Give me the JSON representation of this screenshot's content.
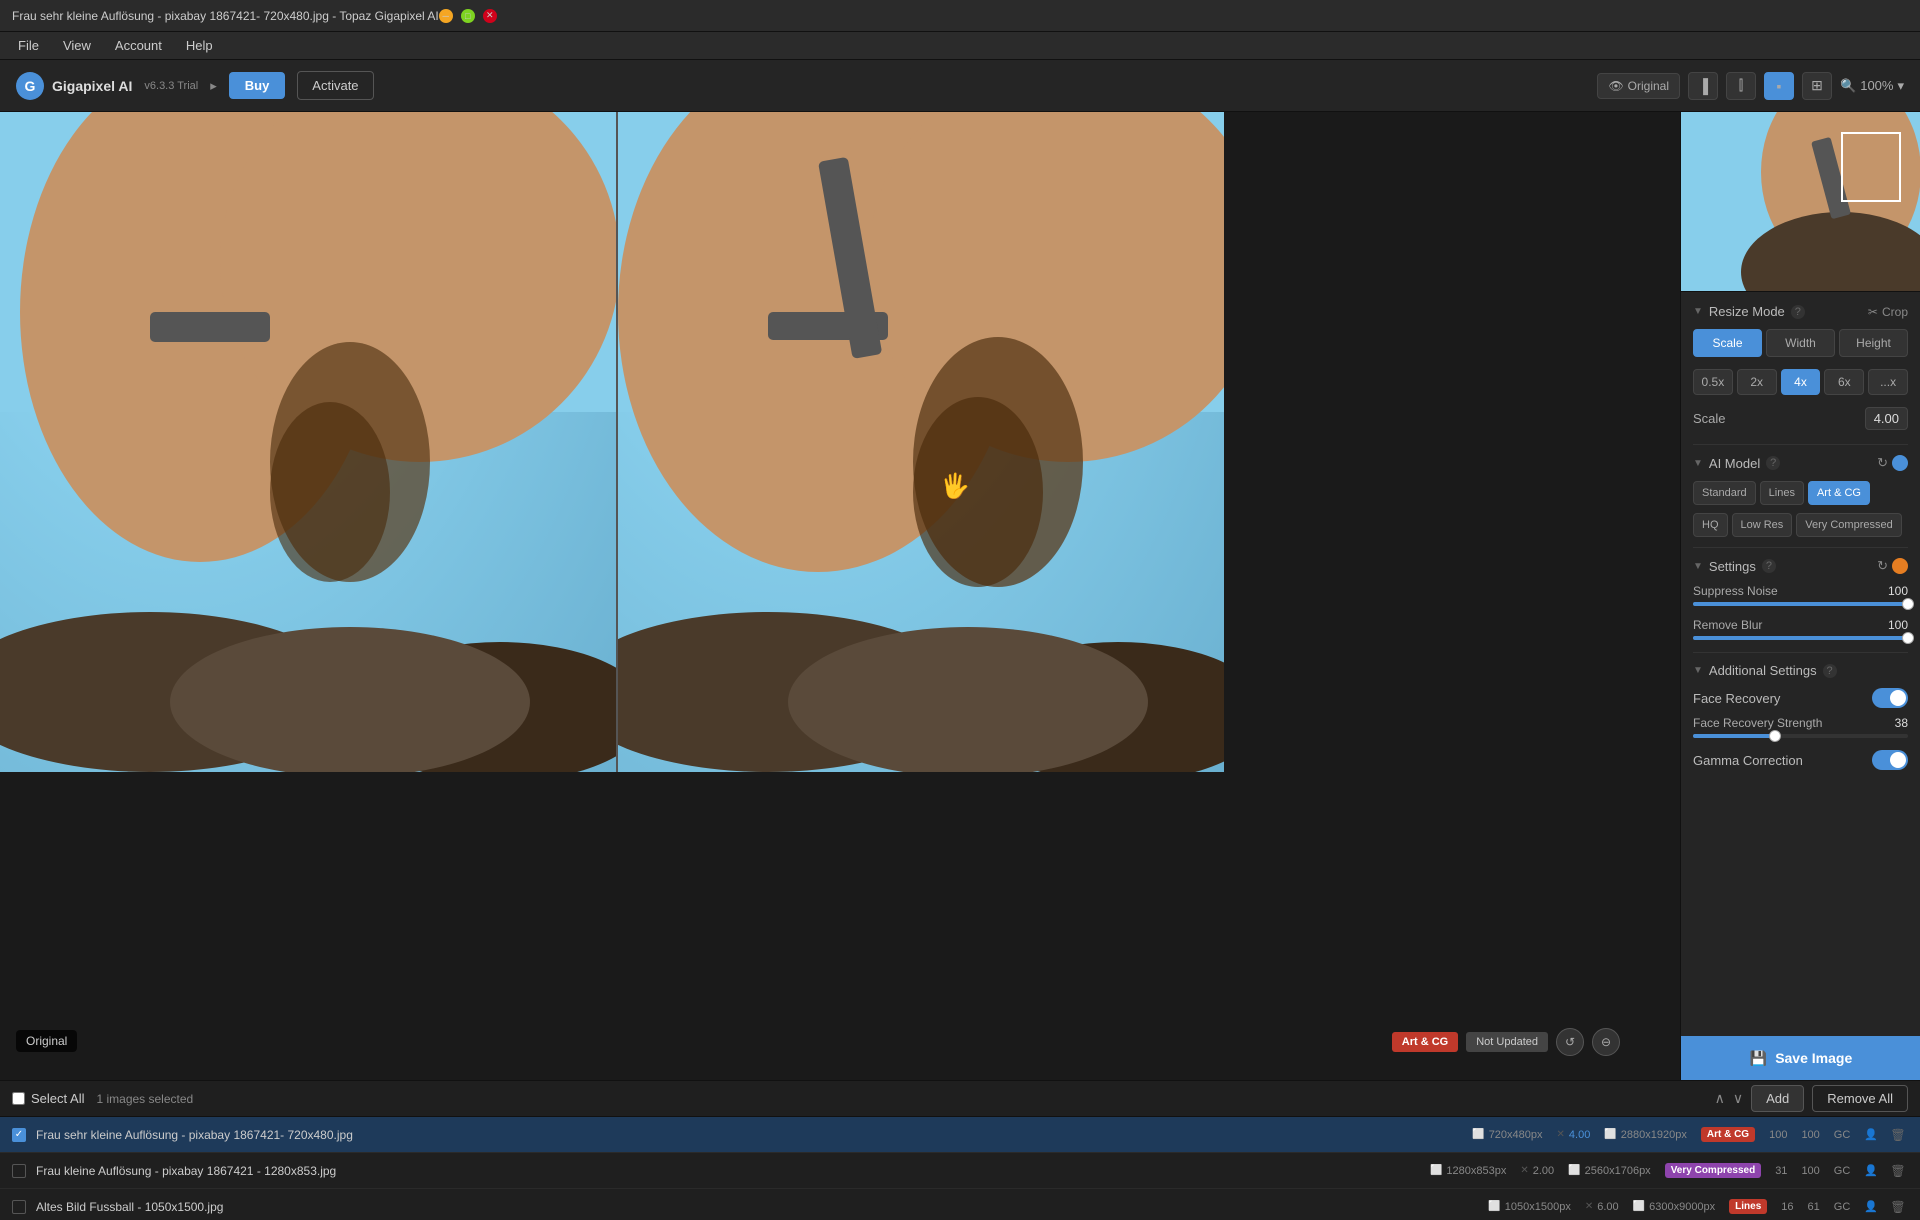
{
  "window": {
    "title": "Frau sehr kleine Auflösung - pixabay 1867421- 720x480.jpg - Topaz Gigapixel AI"
  },
  "menubar": {
    "items": [
      "File",
      "View",
      "Account",
      "Help"
    ]
  },
  "topbar": {
    "logo_letter": "G",
    "app_name": "Gigapixel AI",
    "app_version": "v6.3.3 Trial",
    "arrow": "▸",
    "buy_label": "Buy",
    "activate_label": "Activate",
    "original_label": "Original",
    "zoom_level": "100%"
  },
  "right_panel": {
    "resize_mode_label": "Resize Mode",
    "crop_label": "Crop",
    "scale_tabs": [
      "Scale",
      "Width",
      "Height"
    ],
    "scale_values": [
      "0.5x",
      "2x",
      "4x",
      "6x",
      "...x"
    ],
    "scale_label": "Scale",
    "scale_value": "4.00",
    "ai_model_label": "AI Model",
    "model_tabs": [
      "Standard",
      "Lines",
      "Art & CG"
    ],
    "quality_tabs": [
      "HQ",
      "Low Res",
      "Very Compressed"
    ],
    "settings_label": "Settings",
    "suppress_noise_label": "Suppress Noise",
    "suppress_noise_value": "100",
    "suppress_noise_pct": 100,
    "remove_blur_label": "Remove Blur",
    "remove_blur_value": "100",
    "remove_blur_pct": 100,
    "additional_settings_label": "Additional Settings",
    "face_recovery_label": "Face Recovery",
    "face_recovery_strength_label": "Face Recovery Strength",
    "face_recovery_strength_value": "38",
    "face_recovery_strength_pct": 38,
    "gamma_correction_label": "Gamma Correction",
    "save_label": "Save Image"
  },
  "canvas": {
    "original_label": "Original",
    "ai_badge": "Art & CG",
    "not_updated_badge": "Not Updated"
  },
  "file_list": {
    "select_all_label": "Select All",
    "selected_count": "1 images selected",
    "add_label": "Add",
    "remove_all_label": "Remove All",
    "files": [
      {
        "name": "Frau sehr kleine Auflösung - pixabay 1867421- 720x480.jpg",
        "selected": true,
        "checked": true,
        "input_size": "720x480px",
        "scale": "4.00",
        "output_size": "2880x1920px",
        "model": "Art & CG",
        "model_class": "tag-art",
        "noise": "100",
        "blur": "100",
        "has_gc": true
      },
      {
        "name": "Frau kleine Auflösung - pixabay 1867421 - 1280x853.jpg",
        "selected": false,
        "checked": false,
        "input_size": "1280x853px",
        "scale": "2.00",
        "output_size": "2560x1706px",
        "model": "Very Compressed",
        "model_class": "tag-compressed",
        "noise": "31",
        "blur": "100",
        "has_gc": true
      },
      {
        "name": "Altes Bild Fussball - 1050x1500.jpg",
        "selected": false,
        "checked": false,
        "input_size": "1050x1500px",
        "scale": "6.00",
        "output_size": "6300x9000px",
        "model": "Lines",
        "model_class": "tag-lines",
        "noise": "16",
        "blur": "61",
        "has_gc": true
      }
    ]
  }
}
